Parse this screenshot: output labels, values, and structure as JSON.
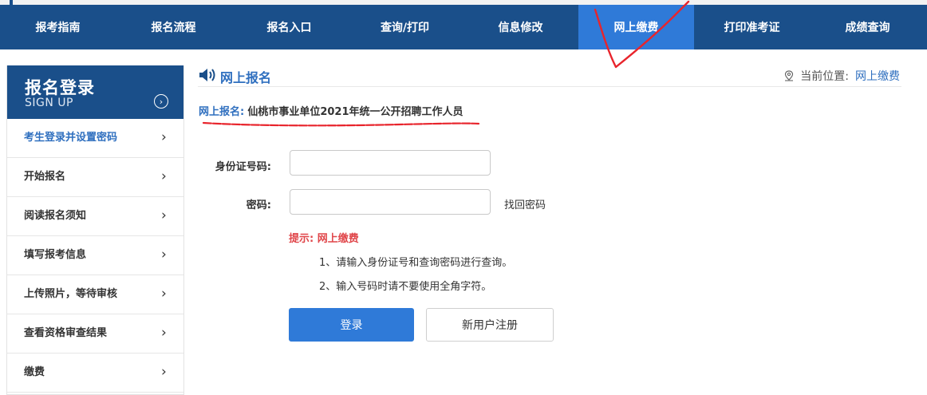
{
  "nav": {
    "items": [
      {
        "label": "报考指南"
      },
      {
        "label": "报名流程"
      },
      {
        "label": "报名入口"
      },
      {
        "label": "查询/打印"
      },
      {
        "label": "信息修改"
      },
      {
        "label": "网上缴费"
      },
      {
        "label": "打印准考证"
      },
      {
        "label": "成绩查询"
      }
    ],
    "active_index": 5
  },
  "sidebar": {
    "title": "报名登录",
    "subtitle": "SIGN UP",
    "items": [
      {
        "label": "考生登录并设置密码"
      },
      {
        "label": "开始报名"
      },
      {
        "label": "阅读报名须知"
      },
      {
        "label": "填写报考信息"
      },
      {
        "label": "上传照片，等待审核"
      },
      {
        "label": "查看资格审查结果"
      },
      {
        "label": "缴费"
      }
    ]
  },
  "content": {
    "title": "网上报名",
    "location_label": "当前位置:",
    "location_current": "网上缴费",
    "subtitle_label": "网上报名:",
    "subtitle_value": "仙桃市事业单位2021年统一公开招聘工作人员"
  },
  "form": {
    "id_label": "身份证号码:",
    "id_value": "",
    "password_label": "密码:",
    "password_value": "",
    "find_password": "找回密码",
    "tip_title": "提示: 网上缴费",
    "tip_lines": [
      "1、请输入身份证号和查询密码进行查询。",
      "2、输入号码时请不要使用全角字符。"
    ],
    "login_label": "登录",
    "register_label": "新用户注册"
  },
  "colors": {
    "nav_bg": "#1a4f8a",
    "nav_active": "#2f7ad8",
    "link_blue": "#2f6fbf",
    "tip_red": "#e0464a",
    "annotation_red": "#e8242c"
  }
}
